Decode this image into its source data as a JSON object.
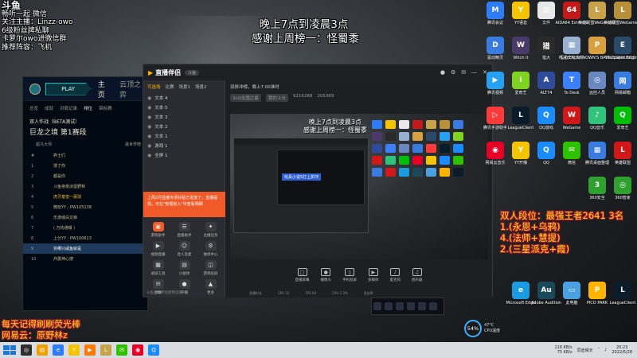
{
  "overlay": {
    "top_left_logo": "斗鱼",
    "top_left_lines": [
      "畅听一起 微信",
      "关注主播：Linzz-owo",
      "6级粉丝牌私聊",
      "卡萝尔owo进微信群",
      "推荐阵容：飞机"
    ],
    "header_line1": "晚上7点到凌晨3点",
    "header_line2": "感谢上周榜一：怪蜀黍",
    "right_lines": [
      "双人段位：最强王者2641 3名",
      "1.(永恩+乌鸦)",
      "4.(法师+慧提)",
      "2.(三星派克+霞)"
    ],
    "bottom_left_lines": [
      "每天记得刷刷荧光棒",
      "网易云：原野林z"
    ]
  },
  "lol_client": {
    "play_label": "PLAY",
    "nav_home": "主页",
    "nav_tft": "云顶之弈",
    "subnav": [
      "总览",
      "成就",
      "对局记录",
      "排位",
      "锦标赛"
    ],
    "active_subnav_index": 3,
    "mode_label": "双人作战（BETA测试）",
    "rank_title": "巨龙之境 第1赛段",
    "col_left": "超凡大师",
    "col_right": "最世界榜",
    "rows": [
      {
        "num": "#",
        "name": "弈士们"
      },
      {
        "num": "1",
        "name": "馒了你"
      },
      {
        "num": "2",
        "name": "都是你"
      },
      {
        "num": "3",
        "name": "斗鱼夜夜凉蛋野林"
      },
      {
        "num": "4",
        "name": "虎牙童悦一晨球"
      },
      {
        "num": "5",
        "name": "微玩YY · PW105138"
      },
      {
        "num": "6",
        "name": "乐游城白文锋"
      },
      {
        "num": "7",
        "name": "( 万钧通曝 )"
      },
      {
        "num": "8",
        "name": "上分YY · PW100613"
      },
      {
        "num": "9",
        "name": "穷哪只咸鱼就是"
      },
      {
        "num": "10",
        "name": "炸勇神心搜"
      }
    ]
  },
  "streamer_app": {
    "title": "直播伴侣",
    "badge": "斗鱼",
    "tabs": [
      "可选场",
      "比赛",
      "场景1",
      "场景2"
    ],
    "active_tab_index": 0,
    "scene_items": [
      "文本 4",
      "文本 5",
      "文本 3",
      "文本 2",
      "文本 1",
      "游戏 1",
      "全屏 1"
    ],
    "promo_text": "上周2月直播专项补贴已发放了，直播提现，可在\"管理收入\"中查看明细",
    "tools": [
      {
        "label": "游戏助手",
        "icon": "▣"
      },
      {
        "label": "直播助手",
        "icon": "☰"
      },
      {
        "label": "主播任务",
        "icon": "✦"
      },
      {
        "label": "视频直播",
        "icon": "▶"
      },
      {
        "label": "连人连麦",
        "icon": "☺"
      },
      {
        "label": "维修中心",
        "icon": "⚙"
      },
      {
        "label": "录屏工具",
        "icon": "▦"
      },
      {
        "label": "小剧场",
        "icon": "▤"
      },
      {
        "label": "游戏投屏",
        "icon": "◫"
      },
      {
        "label": "弹幕",
        "icon": "✉"
      },
      {
        "label": "开播",
        "icon": "●"
      },
      {
        "label": "更多",
        "icon": "▲"
      }
    ],
    "footer_note": "斗鱼直播伴侣使用说明",
    "info_title": "双排冲榜，晚上7.00准时",
    "info_tag1": "3cO全国之最",
    "info_tag2": "我的上分",
    "info_count1": "9216288",
    "info_count2": "205369",
    "preview_title_lines": [
      "晚上7点到凌晨3点",
      "感谢上周榜一：怪蜀黍"
    ],
    "preview_tag": "玩具小说5打上拱冲",
    "bottom_buttons": [
      {
        "label": "直播屏幕",
        "icon": "□"
      },
      {
        "label": "摄像头",
        "icon": "●"
      },
      {
        "label": "手机投屏",
        "icon": "▯"
      },
      {
        "label": "多媒体",
        "icon": "▶"
      },
      {
        "label": "麦克风",
        "icon": "♪"
      },
      {
        "label": "扬声器",
        "icon": "♫"
      }
    ],
    "status": [
      "直播时长",
      "CPU 32",
      "FPS 60",
      "CPU 2.3%",
      "丢帧率"
    ]
  },
  "desktop": {
    "icons": [
      {
        "label": "腾讯会议",
        "color": "#2e7df6",
        "glyph": "M"
      },
      {
        "label": "YY语音",
        "color": "#f5c400",
        "glyph": "Y"
      },
      {
        "label": "文件",
        "color": "#e8e8e8",
        "glyph": "▤"
      },
      {
        "label": "AIDA64 Extreme",
        "color": "#c21a1a",
        "glyph": "64"
      },
      {
        "label": "英雄联盟WeGame版",
        "color": "#c8a24a",
        "glyph": "L"
      },
      {
        "label": "英雄联盟WeGame版",
        "color": "#b8903a",
        "glyph": "L"
      },
      {
        "label": "驱动精灵",
        "color": "#3a7be0",
        "glyph": "D"
      },
      {
        "label": "Witch It",
        "color": "#4a3a6a",
        "glyph": "W"
      },
      {
        "label": "猎大",
        "color": "#2a2a2a",
        "glyph": "猎"
      },
      {
        "label": "恒星文化文件",
        "color": "#9ab0d0",
        "glyph": "▦"
      },
      {
        "label": "PLAYERUNKNOWN'S BATTLEGROUNDS",
        "color": "#d8a040",
        "glyph": "P"
      },
      {
        "label": "Wallpaper Engine",
        "color": "#2a4a6a",
        "glyph": "E"
      },
      {
        "label": "腾讯视频",
        "color": "#26a0f0",
        "glyph": "▶"
      },
      {
        "label": "爱奇艺",
        "color": "#7ed321",
        "glyph": "i"
      },
      {
        "label": "ALT74",
        "color": "#2e4a9a",
        "glyph": "A"
      },
      {
        "label": "To Desk",
        "color": "#3a80ff",
        "glyph": "T"
      },
      {
        "label": "远控人员",
        "color": "#6a88c0",
        "glyph": "◎"
      },
      {
        "label": "网易邮箱",
        "color": "#3a7be0",
        "glyph": "网"
      },
      {
        "label": "腾讯手游助手",
        "color": "#ff3a3a",
        "glyph": "▷"
      },
      {
        "label": "LeagueClient",
        "color": "#0a1c2a",
        "glyph": "L"
      },
      {
        "label": "QQ游戏",
        "color": "#1a8cff",
        "glyph": "Q"
      },
      {
        "label": "WeGame",
        "color": "#d01818",
        "glyph": "W"
      },
      {
        "label": "QQ音乐",
        "color": "#31c27c",
        "glyph": "♪"
      },
      {
        "label": "爱奇艺",
        "color": "#00be06",
        "glyph": "Q"
      },
      {
        "label": "网易云音乐",
        "color": "#e60026",
        "glyph": "◉"
      },
      {
        "label": "YY开播",
        "color": "#f5c400",
        "glyph": "Y"
      },
      {
        "label": "QQ",
        "color": "#1a8cff",
        "glyph": "Q"
      },
      {
        "label": "微信",
        "color": "#2dc100",
        "glyph": "✉"
      },
      {
        "label": "腾讯桌面整理",
        "color": "#3a7be0",
        "glyph": "▦"
      },
      {
        "label": "英雄联盟",
        "color": "#d01818",
        "glyph": "L"
      },
      {
        "label": "Microsoft Edge",
        "color": "#1a9be0",
        "glyph": "e"
      },
      {
        "label": "Adobe Audition",
        "color": "#1a4a5a",
        "glyph": "Au"
      },
      {
        "label": "此电脑",
        "color": "#4aa0e0",
        "glyph": "▭"
      },
      {
        "label": "PICO PARK",
        "color": "#ffb400",
        "glyph": "P"
      },
      {
        "label": "LeagueClient",
        "color": "#0a1c2a",
        "glyph": "L"
      },
      {
        "label": "360安全",
        "color": "#30a030",
        "glyph": "3"
      },
      {
        "label": "360管家",
        "color": "#30a030",
        "glyph": "◎"
      }
    ]
  },
  "cpu_widget": {
    "percent": "54%",
    "temp": "47°C",
    "label": "CPU温度"
  },
  "taskbar": {
    "time": "20:23",
    "date": "2022/6/28",
    "net_up": "116 KB/s",
    "net_down": "75 KB/s",
    "weather": "同途晴天",
    "apps": [
      {
        "color": "#2e2e2e",
        "glyph": "◎"
      },
      {
        "color": "#f0a000",
        "glyph": "▤"
      },
      {
        "color": "#2e7df6",
        "glyph": "e"
      },
      {
        "color": "#f5c400",
        "glyph": "Y"
      },
      {
        "color": "#ff7a00",
        "glyph": "▶"
      },
      {
        "color": "#c8a24a",
        "glyph": "L"
      },
      {
        "color": "#2dc100",
        "glyph": "✉"
      },
      {
        "color": "#e60026",
        "glyph": "◉"
      },
      {
        "color": "#1a8cff",
        "glyph": "Q"
      }
    ]
  }
}
